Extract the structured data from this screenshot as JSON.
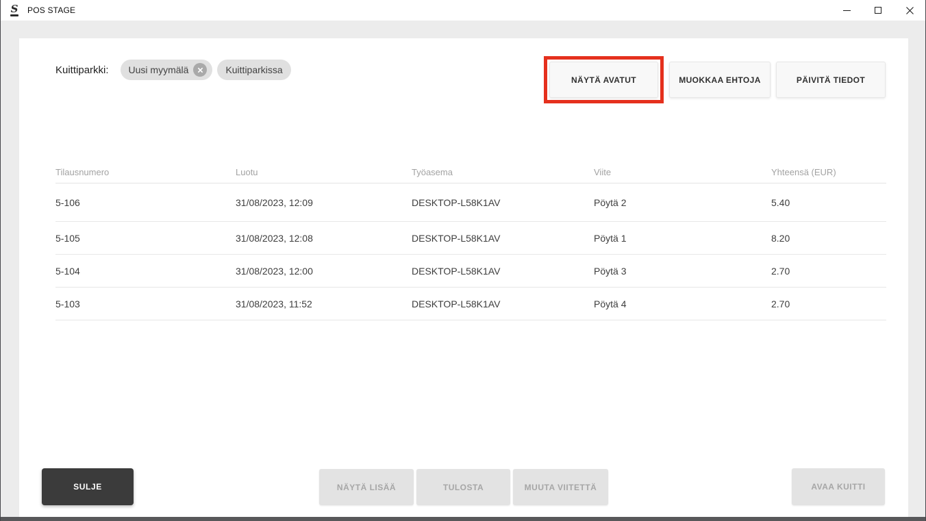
{
  "window": {
    "title": "POS STAGE",
    "logo_letter": "S"
  },
  "filter": {
    "label": "Kuittiparkki:",
    "chips": [
      {
        "label": "Uusi myymälä",
        "removable": true
      },
      {
        "label": "Kuittiparkissa",
        "removable": false
      }
    ]
  },
  "toolbar": {
    "buttons": [
      {
        "label": "NÄYTÄ AVATUT",
        "highlighted": true
      },
      {
        "label": "MUOKKAA EHTOJA",
        "highlighted": false
      },
      {
        "label": "PÄIVITÄ TIEDOT",
        "highlighted": false
      }
    ]
  },
  "table": {
    "columns": [
      "Tilausnumero",
      "Luotu",
      "Työasema",
      "Viite",
      "Yhteensä (EUR)"
    ],
    "rows": [
      [
        "5-106",
        "31/08/2023, 12:09",
        "DESKTOP-L58K1AV",
        "Pöytä 2",
        "5.40"
      ],
      [
        "5-105",
        "31/08/2023, 12:08",
        "DESKTOP-L58K1AV",
        "Pöytä 1",
        "8.20"
      ],
      [
        "5-104",
        "31/08/2023, 12:00",
        "DESKTOP-L58K1AV",
        "Pöytä 3",
        "2.70"
      ],
      [
        "5-103",
        "31/08/2023, 11:52",
        "DESKTOP-L58K1AV",
        "Pöytä 4",
        "2.70"
      ]
    ]
  },
  "footer": {
    "close_label": "SULJE",
    "actions": [
      {
        "label": "NÄYTÄ LISÄÄ",
        "disabled": true
      },
      {
        "label": "TULOSTA",
        "disabled": true
      },
      {
        "label": "MUUTA VIITETTÄ",
        "disabled": true
      }
    ],
    "open_receipt_label": "AVAA KUITTI",
    "open_receipt_disabled": true
  },
  "icons": {
    "app_logo": "s-logo",
    "chip_remove": "circle-x",
    "minimize": "minimize-line",
    "maximize": "maximize-square",
    "close": "close-x"
  },
  "colors": {
    "annotation_red": "#e5301d",
    "dark_button": "#3b3b3b",
    "frame_gray": "#ececec",
    "chip_gray": "#e0e0e0",
    "disabled_bg": "#e3e3e3",
    "disabled_text": "#a6a6a6",
    "header_text": "#a2a2a2",
    "row_text": "#3d3d3d",
    "bottom_bar": "#58585a"
  }
}
